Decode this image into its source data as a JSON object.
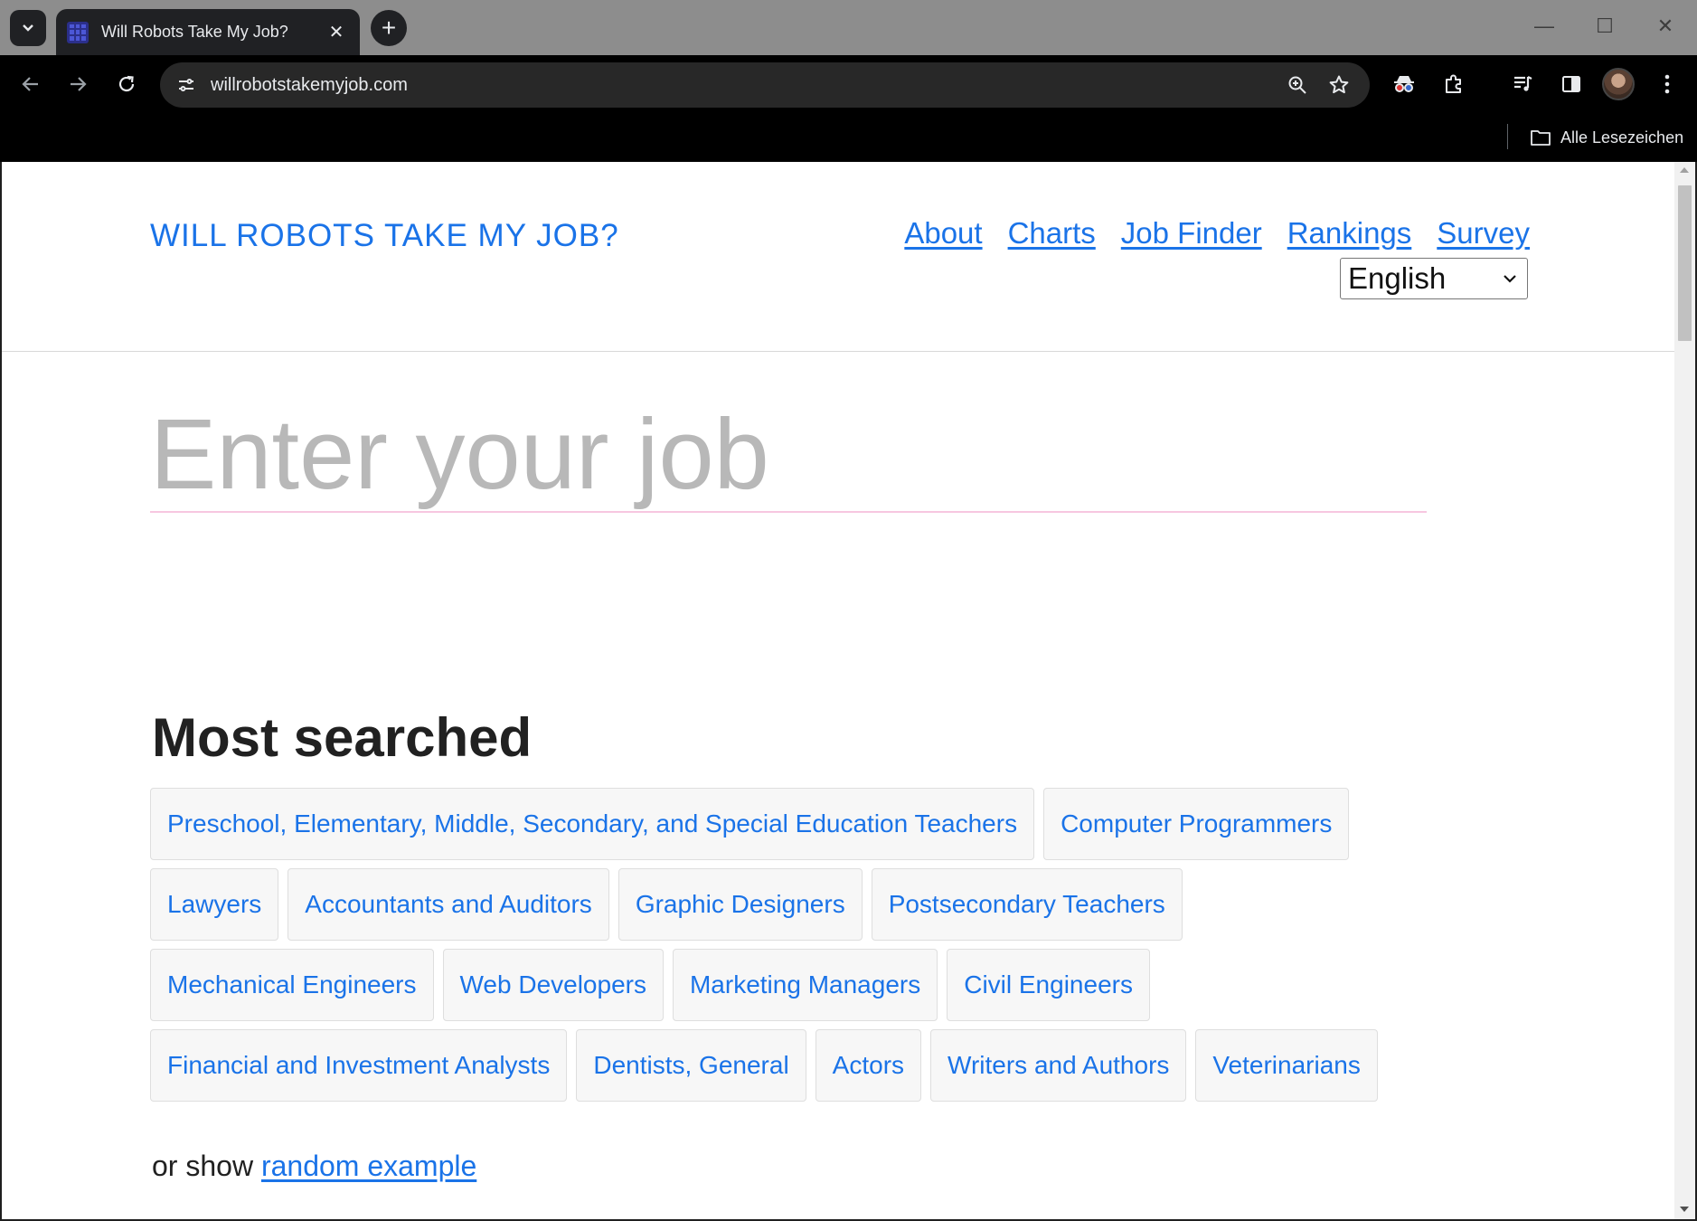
{
  "browser": {
    "tab_title": "Will Robots Take My Job?",
    "tab_close": "✕",
    "new_tab": "+",
    "url": "willrobotstakemyjob.com",
    "bookmarks_label": "Alle Lesezeichen",
    "window_controls": {
      "minimize": "—",
      "maximize": "☐",
      "close": "✕"
    },
    "icons": {
      "tab_list": "chevron-down-icon",
      "back": "arrow-left-icon",
      "forward": "arrow-right-icon",
      "reload": "reload-icon",
      "site_info": "tune-icon",
      "zoom": "zoom-icon",
      "bookmark": "star-icon",
      "extensions": [
        "incognito-glasses-icon",
        "puzzle-icon",
        "media-queue-icon",
        "side-panel-icon"
      ],
      "menu": "kebab-menu-icon",
      "folder": "folder-icon"
    }
  },
  "site": {
    "brand": "WILL ROBOTS TAKE MY JOB?",
    "nav": [
      "About",
      "Charts",
      "Job Finder",
      "Rankings",
      "Survey"
    ],
    "language": "English",
    "search_placeholder": "Enter your job",
    "most_searched_title": "Most searched",
    "most_searched": [
      "Preschool, Elementary, Middle, Secondary, and Special Education Teachers",
      "Computer Programmers",
      "Lawyers",
      "Accountants and Auditors",
      "Graphic Designers",
      "Postsecondary Teachers",
      "Mechanical Engineers",
      "Web Developers",
      "Marketing Managers",
      "Civil Engineers",
      "Financial and Investment Analysts",
      "Dentists, General",
      "Actors",
      "Writers and Authors",
      "Veterinarians"
    ],
    "random_prefix": "or show",
    "random_link": "random example"
  },
  "colors": {
    "link": "#1a73e8",
    "chip_bg": "#f7f7f7",
    "input_underline": "#f7c7e0",
    "placeholder": "#b8b8b8"
  }
}
